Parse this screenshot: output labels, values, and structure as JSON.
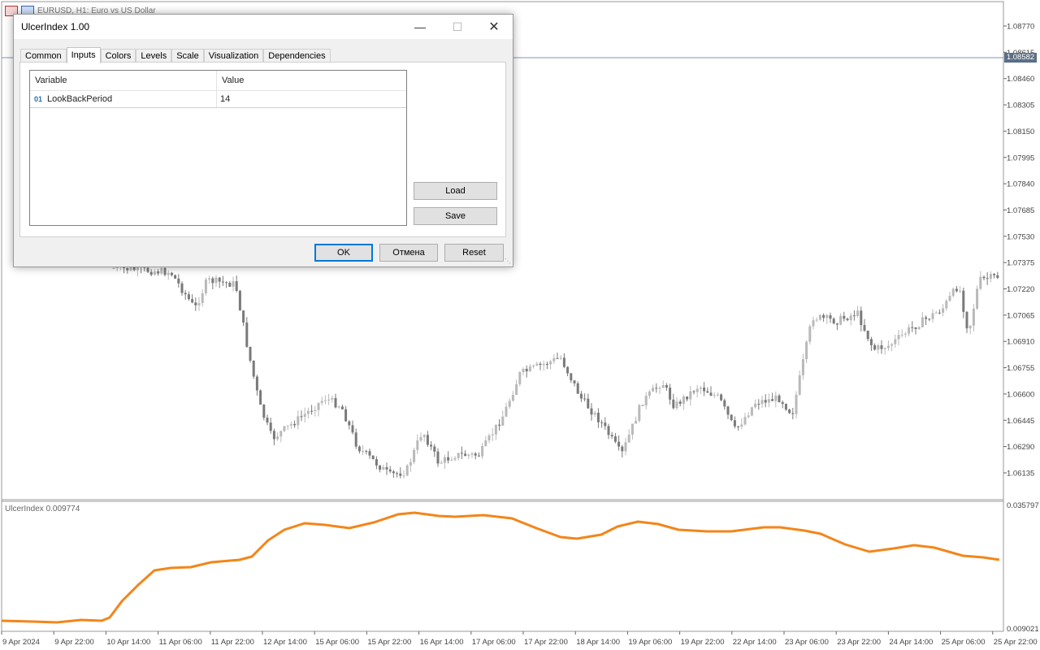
{
  "chart": {
    "window_title": "EURUSD, H1:  Euro vs US Dollar",
    "current_price": "1.08582",
    "price_axis_labels": [
      "1.08770",
      "1.08615",
      "1.08460",
      "1.08305",
      "1.08150",
      "1.07995",
      "1.07840",
      "1.07685",
      "1.07530",
      "1.07375",
      "1.07220",
      "1.07065",
      "1.06910",
      "1.06755",
      "1.06600",
      "1.06445",
      "1.06290",
      "1.06135"
    ],
    "time_axis_labels": [
      "9 Apr 2024",
      "9 Apr 22:00",
      "10 Apr 14:00",
      "11 Apr 06:00",
      "11 Apr 22:00",
      "12 Apr 14:00",
      "15 Apr 06:00",
      "15 Apr 22:00",
      "16 Apr 14:00",
      "17 Apr 06:00",
      "17 Apr 22:00",
      "18 Apr 14:00",
      "19 Apr 06:00",
      "19 Apr 22:00",
      "22 Apr 14:00",
      "23 Apr 06:00",
      "23 Apr 22:00",
      "24 Apr 14:00",
      "25 Apr 06:00",
      "25 Apr 22:00"
    ],
    "indicator_title": "UlcerIndex 0.009774",
    "indicator_axis_top": "0.035797",
    "indicator_axis_bottom": "0.009021",
    "colors": {
      "indicator_line": "#f2861a",
      "candles": "#7a7a7a",
      "price_line": "#7f96b0"
    }
  },
  "dialog": {
    "title": "UlcerIndex 1.00",
    "tabs": [
      "Common",
      "Inputs",
      "Colors",
      "Levels",
      "Scale",
      "Visualization",
      "Dependencies"
    ],
    "active_tab": "Inputs",
    "grid": {
      "headers": [
        "Variable",
        "Value"
      ],
      "rows": [
        {
          "type_icon": "01",
          "variable": "LookBackPeriod",
          "value": "14"
        }
      ]
    },
    "buttons": {
      "load": "Load",
      "save": "Save",
      "ok": "OK",
      "cancel": "Отмена",
      "reset": "Reset"
    }
  }
}
